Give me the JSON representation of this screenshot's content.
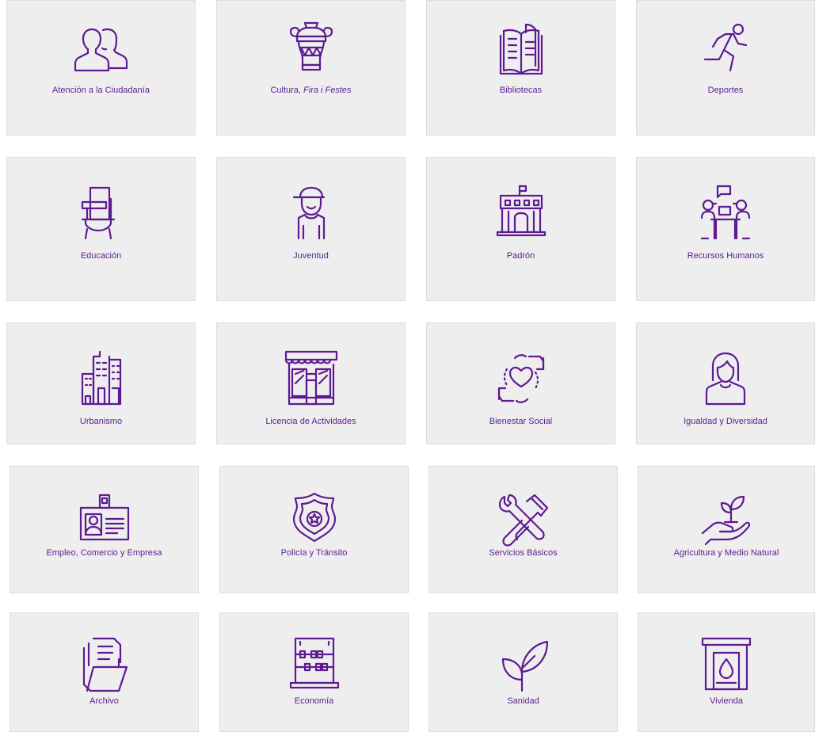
{
  "colors": {
    "accent": "#5e1a91",
    "tile_bg": "#efeeef",
    "label": "#5a1d8c"
  },
  "tiles": [
    {
      "label": "Atención a la Ciudadanía",
      "icon": "people-icon"
    },
    {
      "label": "Cultura, ",
      "label_em": "Fira i Festes",
      "icon": "vase-icon"
    },
    {
      "label": "Bibliotecas",
      "icon": "book-icon"
    },
    {
      "label": "Deportes",
      "icon": "runner-icon"
    },
    {
      "label": "Educación",
      "icon": "school-desk-icon"
    },
    {
      "label": "Juventud",
      "icon": "young-person-icon"
    },
    {
      "label": "Padrón",
      "icon": "town-hall-icon"
    },
    {
      "label": "Recursos Humanos",
      "icon": "meeting-icon"
    },
    {
      "label": "Urbanismo",
      "icon": "buildings-icon"
    },
    {
      "label": "Licencia de Actividades",
      "icon": "shop-icon"
    },
    {
      "label": "Bienestar Social",
      "icon": "hands-heart-icon"
    },
    {
      "label": "Igualdad y Diversidad",
      "icon": "woman-icon"
    },
    {
      "label": "Empleo, Comercio y Empresa",
      "icon": "id-badge-icon"
    },
    {
      "label": "Policía y Tránsito",
      "icon": "police-badge-icon"
    },
    {
      "label": "Servicios Básicos",
      "icon": "tools-icon"
    },
    {
      "label": "Agricultura y Medio Natural",
      "icon": "hand-plant-icon"
    },
    {
      "label": "Archivo",
      "icon": "folder-icon"
    },
    {
      "label": "Economía",
      "icon": "abacus-icon"
    },
    {
      "label": "Sanidad",
      "icon": "sprout-icon"
    },
    {
      "label": "Vivienda",
      "icon": "fireplace-icon"
    }
  ]
}
